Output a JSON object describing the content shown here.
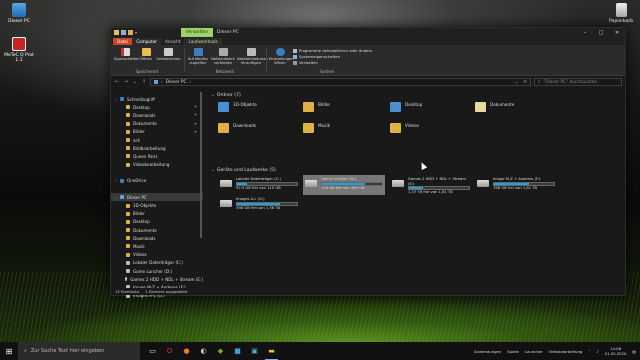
{
  "desktop": {
    "icons": [
      {
        "label": "Dieser PC",
        "icon": "pc-icon"
      },
      {
        "label": "MeTeC Q Prot 1.1",
        "icon": "app-icon"
      },
      {
        "label": "Papierkorb",
        "icon": "recycle-bin-icon"
      }
    ]
  },
  "window": {
    "title": "Dieser PC",
    "context_tab": "Verwalten",
    "tabs": [
      "Datei",
      "Computer",
      "Ansicht",
      "Laufwerktools"
    ],
    "ribbon": {
      "groups": [
        {
          "label": "Speicherort",
          "buttons": [
            "Eigenschaften",
            "Öffnen",
            "Umbenennen"
          ]
        },
        {
          "label": "Netzwerk",
          "buttons": [
            "Auf Medien zugreifen",
            "Netzlaufwerk verbinden",
            "Netzwerkadresse hinzufügen"
          ]
        },
        {
          "label": "System",
          "buttons": [
            "Einstellungen öffnen"
          ]
        }
      ],
      "system_rows": [
        "Programme deinstallieren oder ändern",
        "Systemeigenschaften",
        "Verwalten"
      ]
    },
    "address": {
      "path": "Dieser PC",
      "search_placeholder": "\"Dieser PC\" durchsuchen"
    },
    "sidebar": [
      {
        "label": "Schnellzugriff",
        "level": 0,
        "pin": false
      },
      {
        "label": "Desktop",
        "level": 1,
        "pin": true
      },
      {
        "label": "Downloads",
        "level": 1,
        "pin": true
      },
      {
        "label": "Dokumente",
        "level": 1,
        "pin": true
      },
      {
        "label": "Bilder",
        "level": 1,
        "pin": true
      },
      {
        "label": "ar4",
        "level": 1,
        "pin": false
      },
      {
        "label": "Bildbearbeitung",
        "level": 1,
        "pin": false
      },
      {
        "label": "Queen Paris",
        "level": 1,
        "pin": false
      },
      {
        "label": "Videobearbeitung",
        "level": 1,
        "pin": false
      },
      {
        "label": "",
        "level": 0,
        "pin": false
      },
      {
        "label": "OneDrive",
        "level": 0,
        "pin": false
      },
      {
        "label": "",
        "level": 0,
        "pin": false
      },
      {
        "label": "Dieser PC",
        "level": 0,
        "pin": false,
        "selected": true
      },
      {
        "label": "3D-Objekte",
        "level": 1,
        "pin": false
      },
      {
        "label": "Bilder",
        "level": 1,
        "pin": false
      },
      {
        "label": "Desktop",
        "level": 1,
        "pin": false
      },
      {
        "label": "Dokumente",
        "level": 1,
        "pin": false
      },
      {
        "label": "Downloads",
        "level": 1,
        "pin": false
      },
      {
        "label": "Musik",
        "level": 1,
        "pin": false
      },
      {
        "label": "Videos",
        "level": 1,
        "pin": false
      },
      {
        "label": "Lokaler Datenträger (C:)",
        "level": 1,
        "pin": false
      },
      {
        "label": "Game Luncher (D:)",
        "level": 1,
        "pin": false
      },
      {
        "label": "Games 2 HDD + NDL + Stream (E:)",
        "level": 1,
        "pin": false
      },
      {
        "label": "Image M-Z + Anderes (F:)",
        "level": 1,
        "pin": false
      },
      {
        "label": "Images A-L (G:)",
        "level": 1,
        "pin": false
      }
    ],
    "folders_header": "Ordner (7)",
    "folders": [
      "3D-Objekte",
      "Bilder",
      "Desktop",
      "Dokumente",
      "Downloads",
      "Musik",
      "Videos"
    ],
    "drives_header": "Geräte und Laufwerke (5)",
    "drives": [
      {
        "name": "Lokaler Datenträger (C:)",
        "free": "92,9 GB frei von 110 GB",
        "used": 0.16,
        "selected": false
      },
      {
        "name": "Game Luncher (D:)",
        "free": "133 GB frei von 465 GB",
        "used": 0.71,
        "selected": true
      },
      {
        "name": "Games 2 HDD + NDL + Stream (E:)",
        "free": "1,37 TB frei von 1,81 TB",
        "used": 0.24,
        "selected": false
      },
      {
        "name": "Image M-Z + Anderes (F:)",
        "free": "788 GB frei von 1,81 TB",
        "used": 0.58,
        "selected": false
      },
      {
        "name": "Images A-L (G:)",
        "free": "398 GB frei von 1,36 TB",
        "used": 0.71,
        "selected": false
      }
    ],
    "status": {
      "count": "12 Elemente",
      "selection": "1 Element ausgewählt"
    }
  },
  "taskbar": {
    "search_placeholder": "Zur Suche Text hier eingeben",
    "right_items": [
      "Anwendungen",
      "Spiele",
      "Launcher",
      "Videobearbeitung"
    ],
    "time": "14:08",
    "date": "01.05.2020"
  },
  "colors": {
    "accent": "#26a0da",
    "context_tab": "#9fd26a",
    "file_tab": "#c8452a"
  }
}
